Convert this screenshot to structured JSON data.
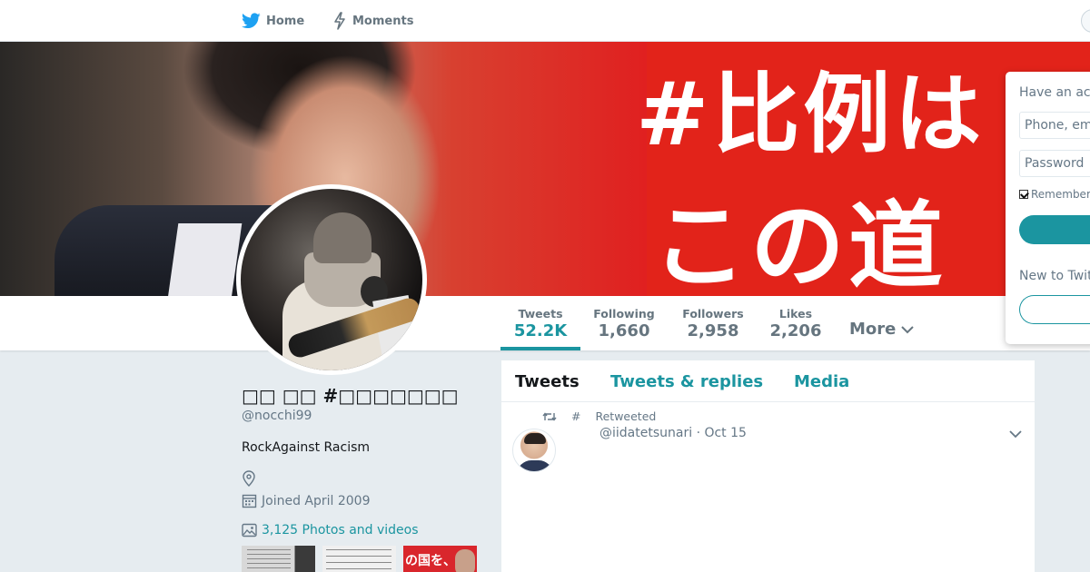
{
  "nav": {
    "home_label": "Home",
    "moments_label": "Moments",
    "home_icon": "twitter-bird-icon",
    "moments_icon": "lightning-icon",
    "accent_color": "#1da1f2"
  },
  "banner": {
    "line1": "#比例は",
    "line2": "この道"
  },
  "profile": {
    "fullname": "□□ □□ #□□□□□□□",
    "handle": "@nocchi99",
    "bio": "RockAgainst Racism",
    "location": "",
    "joined": "Joined April 2009",
    "photos_link": "3,125 Photos and videos",
    "thumb3_text": "の国を、"
  },
  "stats": {
    "tweets": {
      "label": "Tweets",
      "value": "52.2K"
    },
    "following": {
      "label": "Following",
      "value": "1,660"
    },
    "followers": {
      "label": "Followers",
      "value": "2,958"
    },
    "likes": {
      "label": "Likes",
      "value": "2,206"
    },
    "more_label": "More"
  },
  "timeline": {
    "tabs": [
      "Tweets",
      "Tweets & replies",
      "Media"
    ],
    "active_tab": "Tweets",
    "tweet": {
      "retweet_by": "#",
      "retweet_label": "Retweeted",
      "handle": "@iidatetsunari",
      "separator": "·",
      "date": "Oct 15"
    }
  },
  "login": {
    "title": "Have an account?",
    "phone_placeholder": "Phone, email or username",
    "password_placeholder": "Password",
    "remember_label": "Remember me",
    "new_label": "New to Twitter?"
  },
  "colors": {
    "teal_accent": "#1b95a0",
    "banner_red": "#e2231a",
    "page_bg": "#e6ecf0"
  }
}
